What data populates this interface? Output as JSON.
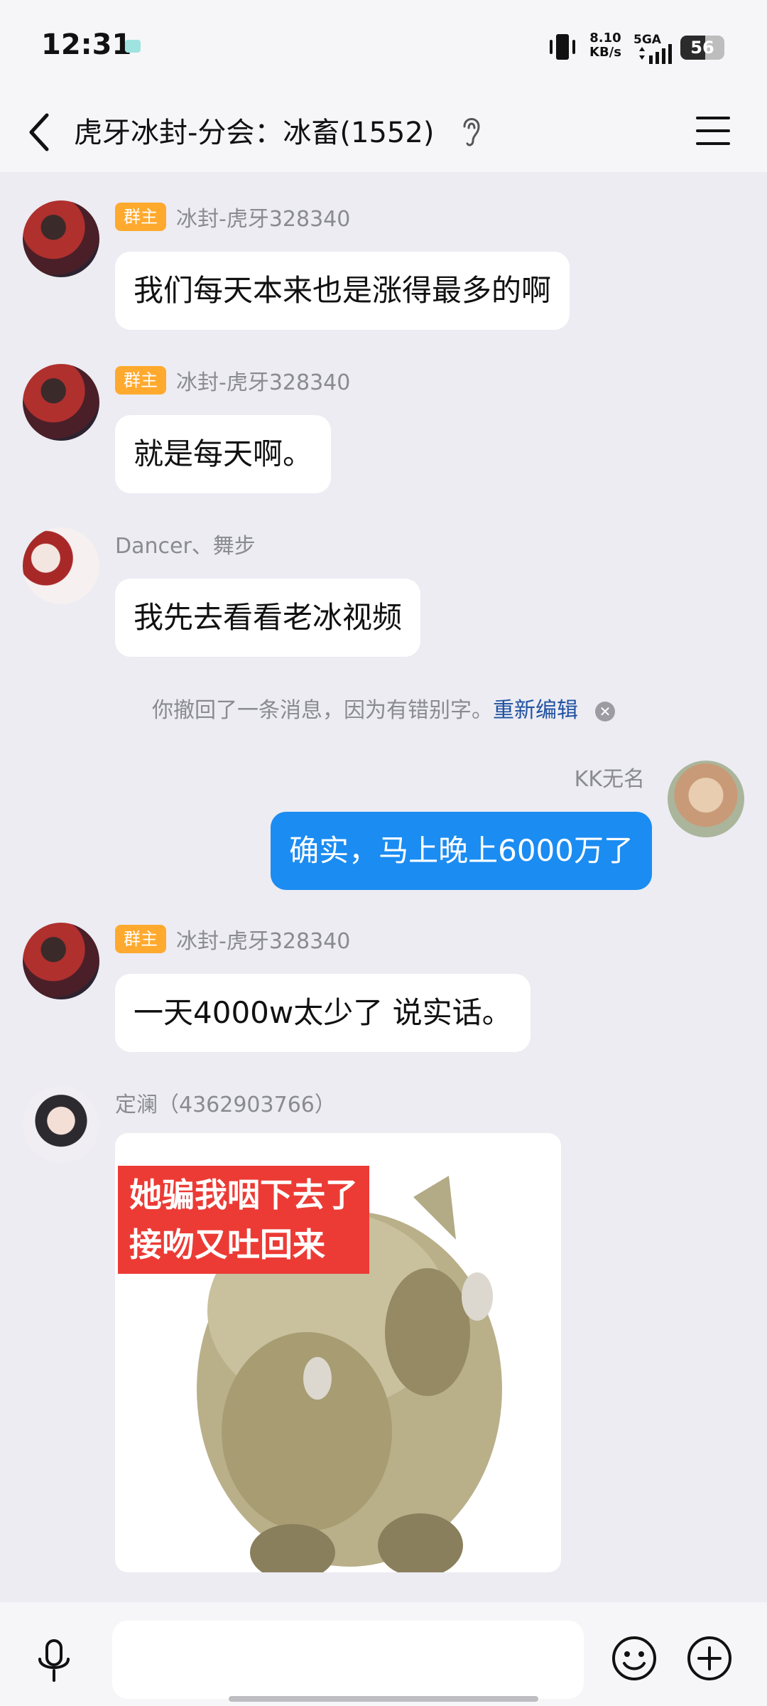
{
  "status_bar": {
    "time": "12:31",
    "net_speed_value": "8.10",
    "net_speed_unit": "KB/s",
    "network_type": "5GA",
    "battery_level": "56",
    "battery_fraction": 0.56
  },
  "header": {
    "title": "虎牙冰封-分会：冰畜(1552)"
  },
  "messages": [
    {
      "sender": "冰封-虎牙328340",
      "badge": "群主",
      "text": "我们每天本来也是涨得最多的啊"
    },
    {
      "sender": "冰封-虎牙328340",
      "badge": "群主",
      "text": "就是每天啊。"
    },
    {
      "sender": "Dancer、舞步",
      "text": "我先去看看老冰视频"
    },
    {
      "sender": "KK无名",
      "text": "确实，马上晚上6000万了",
      "self": true
    },
    {
      "sender": "冰封-虎牙328340",
      "badge": "群主",
      "text": "一天4000w太少了 说实话。"
    },
    {
      "sender": "定澜（4362903766）",
      "sticker_line1": "她骗我咽下去了",
      "sticker_line2": "接吻又吐回来"
    }
  ],
  "system_notice": {
    "text": "你撤回了一条消息，因为有错别字。",
    "link": "重新编辑",
    "close_glyph": "✕"
  },
  "input": {
    "placeholder": ""
  },
  "colors": {
    "accent": "#1b8cf2",
    "owner_badge": "#ffa92e",
    "link": "#2152a3",
    "background": "#ececf2"
  }
}
